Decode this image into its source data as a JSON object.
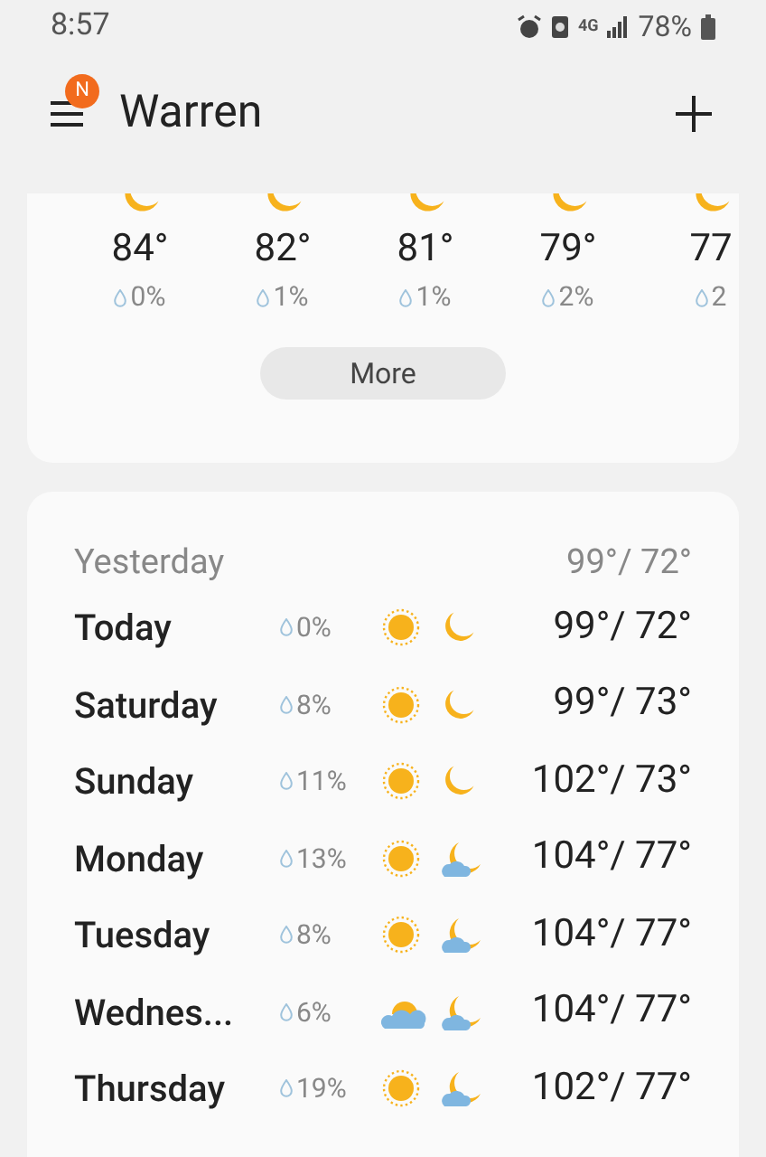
{
  "status_bar": {
    "time": "8:57",
    "network": "4G",
    "battery": "78%"
  },
  "header": {
    "badge": "N",
    "title": "Warren"
  },
  "hourly": [
    {
      "icon": {
        "kind": "moon"
      },
      "temp": "84°",
      "rain": "0%"
    },
    {
      "icon": {
        "kind": "moon"
      },
      "temp": "82°",
      "rain": "1%"
    },
    {
      "icon": {
        "kind": "moon"
      },
      "temp": "81°",
      "rain": "1%"
    },
    {
      "icon": {
        "kind": "moon"
      },
      "temp": "79°",
      "rain": "2%"
    },
    {
      "icon": {
        "kind": "moon"
      },
      "temp": "77",
      "rain": "2"
    }
  ],
  "more_button": "More",
  "yesterday": {
    "label": "Yesterday",
    "temps": "99°/ 72°"
  },
  "daily": [
    {
      "day": "Today",
      "rain": "0%",
      "day_icon": {
        "kind": "sun"
      },
      "night_icon": {
        "kind": "moon"
      },
      "temps": "99°/ 72°"
    },
    {
      "day": "Saturday",
      "rain": "8%",
      "day_icon": {
        "kind": "sun"
      },
      "night_icon": {
        "kind": "moon"
      },
      "temps": "99°/ 73°"
    },
    {
      "day": "Sunday",
      "rain": "11%",
      "day_icon": {
        "kind": "sun"
      },
      "night_icon": {
        "kind": "moon"
      },
      "temps": "102°/ 73°"
    },
    {
      "day": "Monday",
      "rain": "13%",
      "day_icon": {
        "kind": "sun"
      },
      "night_icon": {
        "kind": "cloudy-moon"
      },
      "temps": "104°/ 77°"
    },
    {
      "day": "Tuesday",
      "rain": "8%",
      "day_icon": {
        "kind": "sun"
      },
      "night_icon": {
        "kind": "cloudy-moon"
      },
      "temps": "104°/ 77°"
    },
    {
      "day": "Wednes...",
      "rain": "6%",
      "day_icon": {
        "kind": "partly-cloudy"
      },
      "night_icon": {
        "kind": "cloudy-moon"
      },
      "temps": "104°/ 77°"
    },
    {
      "day": "Thursday",
      "rain": "19%",
      "day_icon": {
        "kind": "sun"
      },
      "night_icon": {
        "kind": "cloudy-moon"
      },
      "temps": "102°/ 77°"
    }
  ]
}
